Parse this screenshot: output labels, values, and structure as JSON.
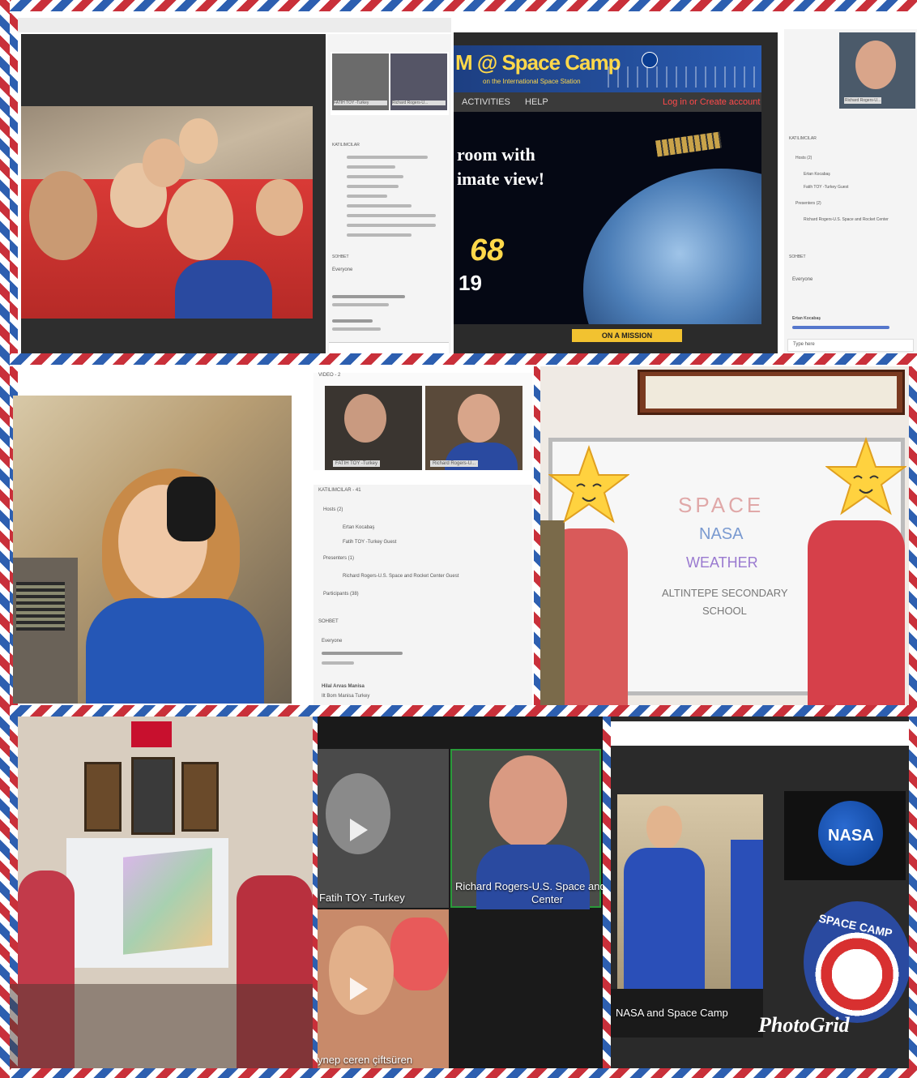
{
  "collage": {
    "panel1": {
      "sidebar_header": "KATILIMCILAR",
      "chat_header": "SOHBET",
      "chat_target": "Everyone",
      "cam_labels": [
        "FATİH TOY -Turkey",
        "Richard Rogers-U..."
      ]
    },
    "panel2": {
      "banner_title": "M @ Space Camp",
      "banner_sub": "on the International Space Station",
      "nav_activities": "ACTIVITIES",
      "nav_help": "HELP",
      "login": "Log in or Create account",
      "hero_line1": "room with",
      "hero_line2": "imate view!",
      "exp_num": "68",
      "exp_year": "19",
      "mission_button": "ON A MISSION",
      "sidebar_header": "KATILIMCILAR",
      "hosts": "Hosts (2)",
      "host1": "Ertan Kocabaş",
      "host2": "Fatih TOY -Turkey Guest",
      "presenters": "Presenters (2)",
      "presenter1": "Richard Rogers-U.S. Space and Rocket Center",
      "chat_header": "SOHBET",
      "chat_target": "Everyone",
      "chat_name": "Ertan Kocabaş",
      "chat_placeholder": "Type here",
      "cam_label": "Richard Rogers-U..."
    },
    "panel4": {
      "video_header": "VIDEO - 2",
      "cam_labels": [
        "FATİH TOY -Turkey",
        "Richard Rogers-U..."
      ],
      "sidebar_header": "KATILIMCILAR - 41",
      "hosts": "Hosts (2)",
      "host1": "Ertan Kocabaş",
      "host2": "Fatih TOY -Turkey Guest",
      "presenters": "Presenters (1)",
      "presenter1": "Richard Rogers-U.S. Space and Rocket Center Guest",
      "participants": "Participants (38)",
      "chat_header": "SOHBET",
      "chat_target": "Everyone",
      "chat_name": "Hilal Arvas Manisa",
      "chat_msg": "Ilt Bom Manisa Turkey"
    },
    "panel5": {
      "board_lines": [
        "SPACE",
        "NASA",
        "WEATHER",
        "ALTINTEPE SECONDARY",
        "SCHOOL"
      ]
    },
    "panel7": {
      "caption1": "Fatih TOY -Turkey",
      "caption2": "Richard Rogers-U.S. Space and R",
      "caption2b": "Center",
      "caption3": "ynep ceren çiftsüren"
    },
    "panel8": {
      "caption": "NASA and Space Camp",
      "nasa_logo": "NASA",
      "space_camp_logo": "SPACE CAMP",
      "watermark": "PhotoGrid"
    }
  },
  "colors": {
    "airmail_red": "#c9303a",
    "airmail_blue": "#2d5fb0",
    "nasa_blue": "#0b3d91",
    "shirt_red": "#d93a36"
  },
  "icons": [
    "play-icon",
    "play-icon",
    "star-mask-icon",
    "star-mask-icon",
    "nasa-logo-icon",
    "space-camp-logo-icon"
  ]
}
